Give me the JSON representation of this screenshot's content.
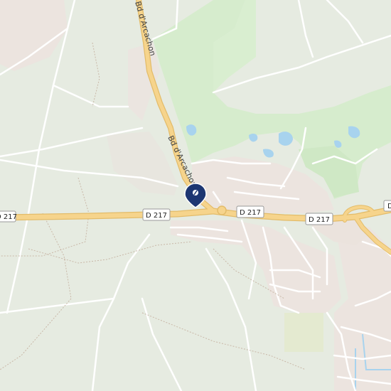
{
  "map": {
    "roads": {
      "primary_route": "D 217",
      "boulevard": "Bd d'Arcachon"
    },
    "shields": [
      "D 217",
      "D 217",
      "D 217",
      "D 217",
      "D"
    ],
    "street_labels": [
      "Bd d'Arcachon",
      "Bd d'Arcachon"
    ],
    "marker": {
      "icon": "location-pin-icon"
    },
    "colors": {
      "land": "#e6ebe1",
      "forest": "#d6eccd",
      "urban": "#ece4df",
      "water": "#a8d3ee",
      "major_road": "#f6d48c",
      "major_road_casing": "#e3bc6a",
      "marker": "#1d3672"
    }
  }
}
